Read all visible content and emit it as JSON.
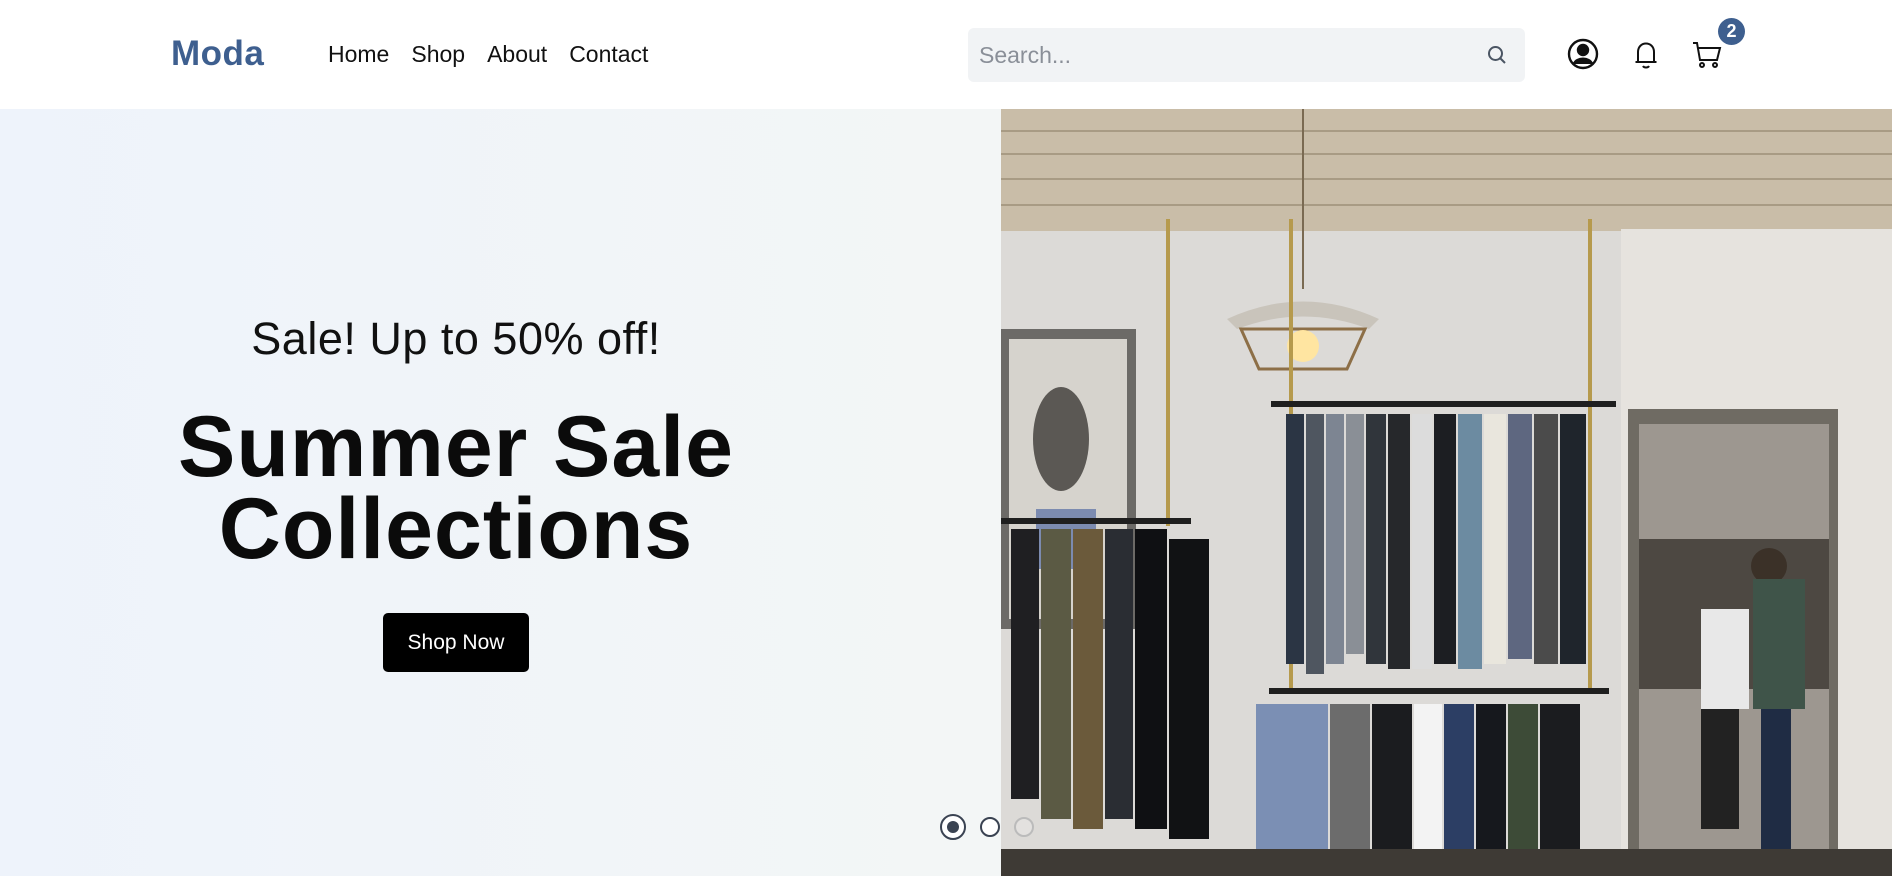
{
  "header": {
    "logo": "Moda",
    "nav": [
      "Home",
      "Shop",
      "About",
      "Contact"
    ],
    "search_placeholder": "Search...",
    "icons": [
      "search-icon",
      "user-icon",
      "bell-icon",
      "cart-icon"
    ],
    "cart_count": "2"
  },
  "hero": {
    "promo": "Sale! Up to 50% off!",
    "title_line1": "Summer Sale",
    "title_line2": "Collections",
    "button_label": "Shop Now",
    "slide_count": 3,
    "active_slide": 1
  },
  "colors": {
    "brand": "#3e5f8f",
    "button": "#000000",
    "hero_bg": "#f2f5f7"
  }
}
